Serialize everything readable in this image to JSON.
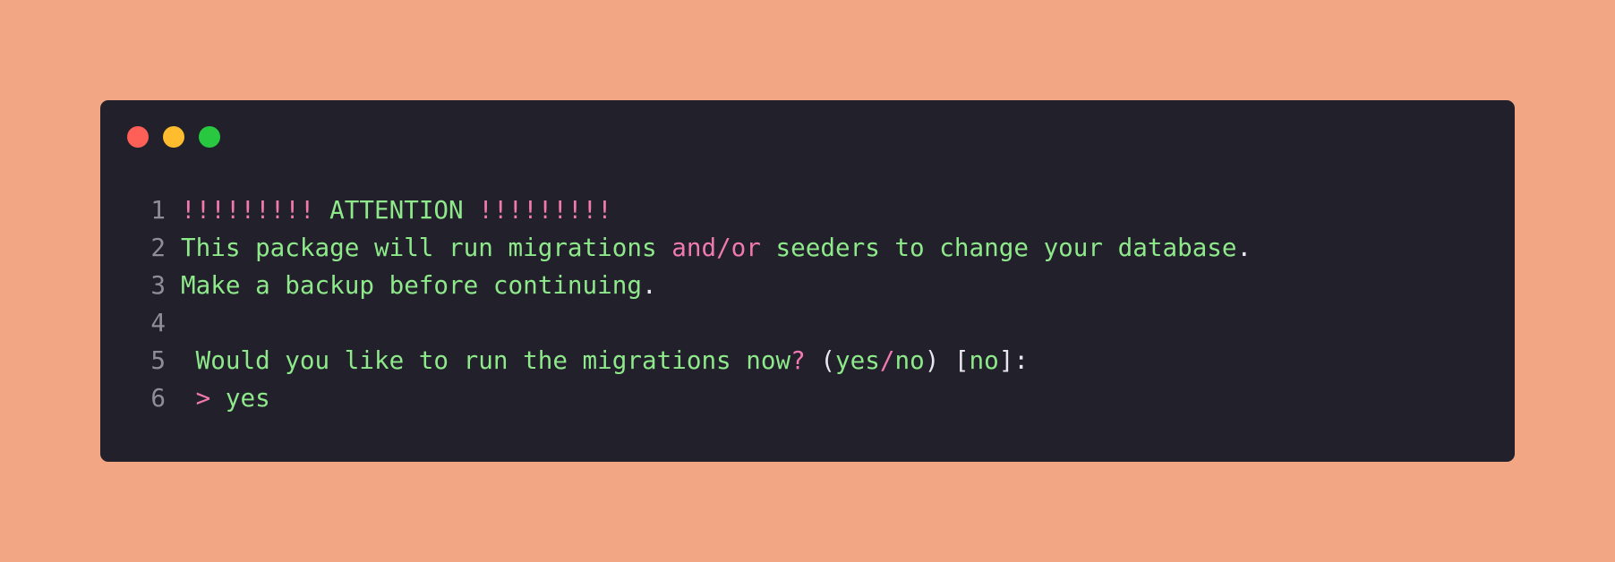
{
  "colors": {
    "background": "#f3a683",
    "window": "#22202b",
    "close": "#fe5f57",
    "minimize": "#febc2e",
    "maximize": "#28c840",
    "green": "#8ee98a",
    "pink": "#f07ab0",
    "line_number": "#8f8d96",
    "punctuation": "#e8e6ee"
  },
  "window_controls": [
    "close-dot",
    "minimize-dot",
    "maximize-dot"
  ],
  "lines": [
    {
      "number": "1",
      "tokens": [
        {
          "text": "!!!!!!!!! ",
          "color": "pink"
        },
        {
          "text": "ATTENTION",
          "color": "green"
        },
        {
          "text": " !!!!!!!!!",
          "color": "pink"
        }
      ]
    },
    {
      "number": "2",
      "tokens": [
        {
          "text": "This package will run migrations ",
          "color": "green"
        },
        {
          "text": "and/or",
          "color": "pink"
        },
        {
          "text": " seeders to change your database",
          "color": "green"
        },
        {
          "text": ".",
          "color": "white"
        }
      ]
    },
    {
      "number": "3",
      "tokens": [
        {
          "text": "Make a backup before continuing",
          "color": "green"
        },
        {
          "text": ".",
          "color": "white"
        }
      ]
    },
    {
      "number": "4",
      "tokens": []
    },
    {
      "number": "5",
      "tokens": [
        {
          "text": " Would you like to run the migrations now",
          "color": "green"
        },
        {
          "text": "?",
          "color": "pink"
        },
        {
          "text": " (",
          "color": "white"
        },
        {
          "text": "yes",
          "color": "green"
        },
        {
          "text": "/",
          "color": "pink"
        },
        {
          "text": "no",
          "color": "green"
        },
        {
          "text": ") [",
          "color": "white"
        },
        {
          "text": "no",
          "color": "green"
        },
        {
          "text": "]:",
          "color": "white"
        }
      ]
    },
    {
      "number": "6",
      "tokens": [
        {
          "text": " > ",
          "color": "pink"
        },
        {
          "text": "yes",
          "color": "green"
        }
      ]
    }
  ]
}
